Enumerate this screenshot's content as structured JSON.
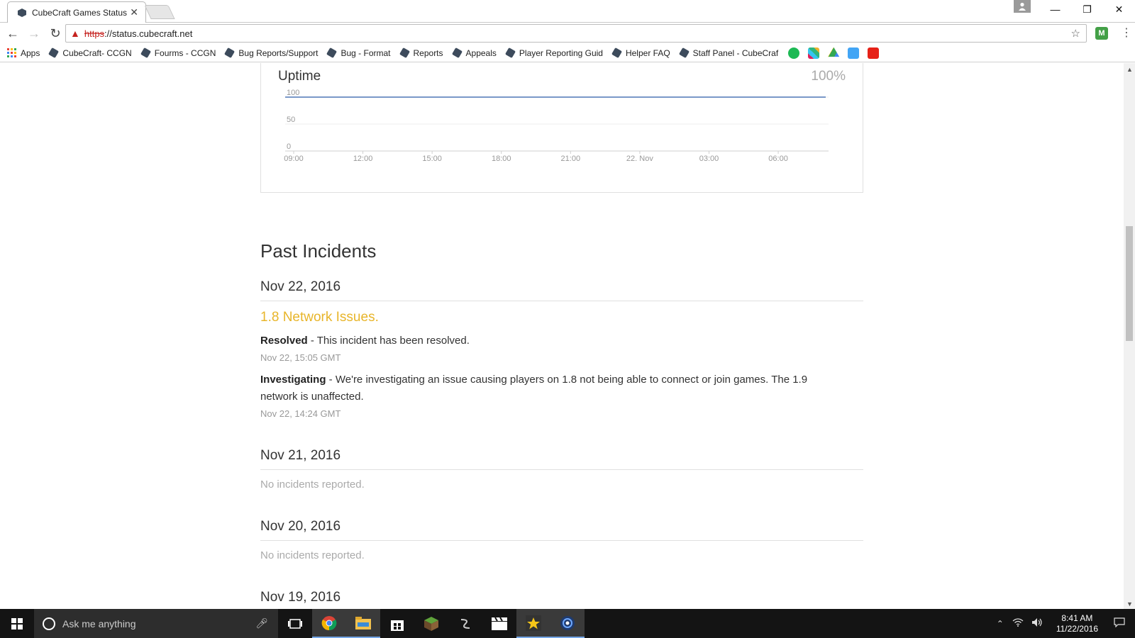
{
  "browser": {
    "tab_title": "CubeCraft Games Status",
    "tab_close": "✕",
    "url_scheme": "https",
    "url_rest": "://status.cubecraft.net",
    "extension_label": "M",
    "window_controls": [
      "—",
      "❐",
      "✕"
    ]
  },
  "bookmarks": [
    {
      "label": "Apps",
      "icon": "apps-grid-icon"
    },
    {
      "label": "CubeCraft- CCGN",
      "icon": "cube-icon"
    },
    {
      "label": "Fourms - CCGN",
      "icon": "cube-icon"
    },
    {
      "label": "Bug Reports/Support",
      "icon": "cube-icon"
    },
    {
      "label": "Bug - Format",
      "icon": "cube-icon"
    },
    {
      "label": "Reports",
      "icon": "cube-icon"
    },
    {
      "label": "Appeals",
      "icon": "cube-icon"
    },
    {
      "label": "Player Reporting Guid",
      "icon": "cube-icon"
    },
    {
      "label": "Helper FAQ",
      "icon": "cube-icon"
    },
    {
      "label": "Staff Panel - CubeCraf",
      "icon": "cube-icon"
    }
  ],
  "bookmark_icons": [
    "spotify-icon",
    "slack-icon",
    "drive-icon",
    "finder-icon",
    "youtube-icon"
  ],
  "uptime": {
    "title": "Uptime",
    "value": "100%"
  },
  "chart_data": {
    "type": "line",
    "x": [
      "09:00",
      "12:00",
      "15:00",
      "18:00",
      "21:00",
      "22. Nov",
      "03:00",
      "06:00"
    ],
    "y_ticks": [
      0,
      50,
      100
    ],
    "ylim": [
      0,
      100
    ],
    "series": [
      {
        "values": [
          100,
          100,
          100,
          100,
          100,
          100,
          100,
          100
        ]
      }
    ],
    "grid": true,
    "line_color": "#2a5aa8"
  },
  "past_incidents": {
    "heading": "Past Incidents",
    "days": [
      {
        "date": "Nov 22, 2016",
        "incident": {
          "name": "1.8 Network Issues.",
          "updates": [
            {
              "status": "Resolved",
              "text": " - This incident has been resolved.",
              "time": "Nov 22, 15:05 GMT"
            },
            {
              "status": "Investigating",
              "text": " - We're investigating an issue causing players on 1.8 not being able to connect or join games. The 1.9 network is unaffected.",
              "time": "Nov 22, 14:24 GMT"
            }
          ]
        }
      },
      {
        "date": "Nov 21, 2016",
        "no_incidents": "No incidents reported."
      },
      {
        "date": "Nov 20, 2016",
        "no_incidents": "No incidents reported."
      },
      {
        "date": "Nov 19, 2016"
      }
    ]
  },
  "taskbar": {
    "search_placeholder": "Ask me anything",
    "time": "8:41 AM",
    "date": "11/22/2016"
  },
  "colors": {
    "incident_accent": "#e8b52a",
    "taskbar_bg": "#141414"
  }
}
